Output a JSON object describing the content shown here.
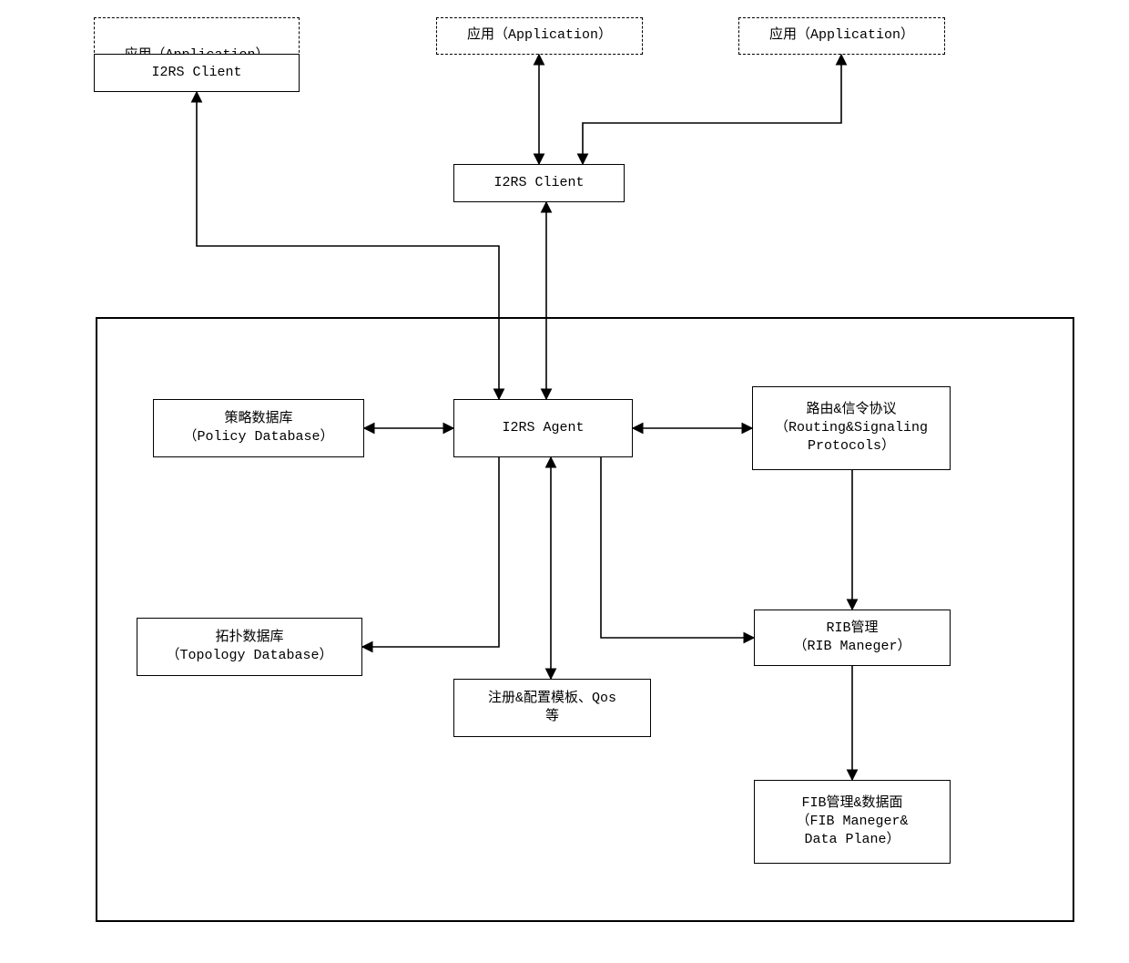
{
  "nodes": {
    "app1_top": "应用（Application）",
    "app1_bottom": "I2RS Client",
    "app2": "应用（Application）",
    "app3": "应用（Application）",
    "i2rs_client": "I2RS Client",
    "i2rs_agent": "I2RS Agent",
    "policy_db_line1": "策略数据库",
    "policy_db_line2": "（Policy Database）",
    "routing_line1": "路由&信令协议",
    "routing_line2": "（Routing&Signaling",
    "routing_line3": "Protocols）",
    "topology_line1": "拓扑数据库",
    "topology_line2": "（Topology Database）",
    "templates_line1": "注册&配置模板、Qos",
    "templates_line2": "等",
    "rib_line1": "RIB管理",
    "rib_line2": "（RIB Maneger）",
    "fib_line1": "FIB管理&数据面",
    "fib_line2": "（FIB Maneger&",
    "fib_line3": "Data Plane）"
  }
}
